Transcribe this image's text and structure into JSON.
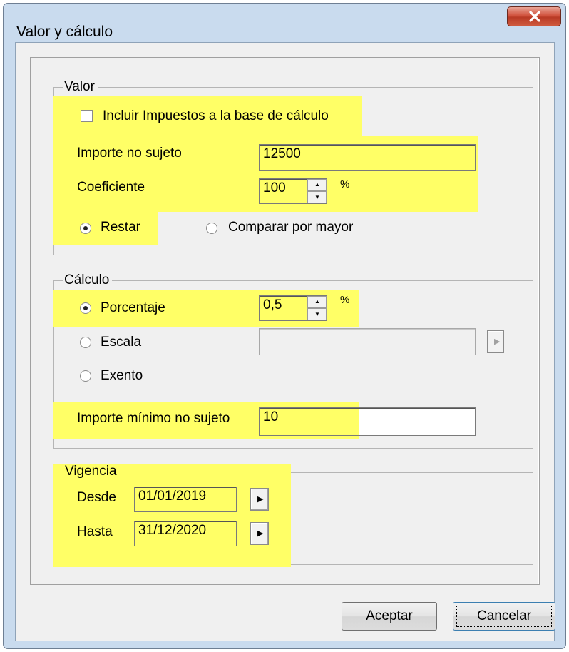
{
  "window": {
    "title": "Valor y cálculo"
  },
  "valor": {
    "legend": "Valor",
    "include_taxes_label": "Incluir Impuestos a la base de cálculo",
    "include_taxes_checked": false,
    "importe_no_sujeto_label": "Importe no sujeto",
    "importe_no_sujeto_value": "12500",
    "coeficiente_label": "Coeficiente",
    "coeficiente_value": "100",
    "coeficiente_unit": "%",
    "restar_label": "Restar",
    "comparar_label": "Comparar por mayor",
    "selected_mode": "Restar"
  },
  "calculo": {
    "legend": "Cálculo",
    "porcentaje_label": "Porcentaje",
    "porcentaje_value": "0,5",
    "porcentaje_unit": "%",
    "escala_label": "Escala",
    "escala_value": "",
    "exento_label": "Exento",
    "selected": "Porcentaje",
    "minimo_label": "Importe mínimo no sujeto",
    "minimo_value": "10"
  },
  "vigencia": {
    "legend": "Vigencia",
    "desde_label": "Desde",
    "desde_value": "01/01/2019",
    "hasta_label": "Hasta",
    "hasta_value": "31/12/2020"
  },
  "buttons": {
    "accept": "Aceptar",
    "cancel": "Cancelar"
  },
  "colors": {
    "highlight": "#ffff66",
    "dialog_bg": "#f0f0f0",
    "frame": "#c9dbee",
    "close": "#c8432d"
  },
  "icons": {
    "close": "close-icon",
    "spin": "spin-updown-icon",
    "picker": "triangle-right-icon"
  }
}
